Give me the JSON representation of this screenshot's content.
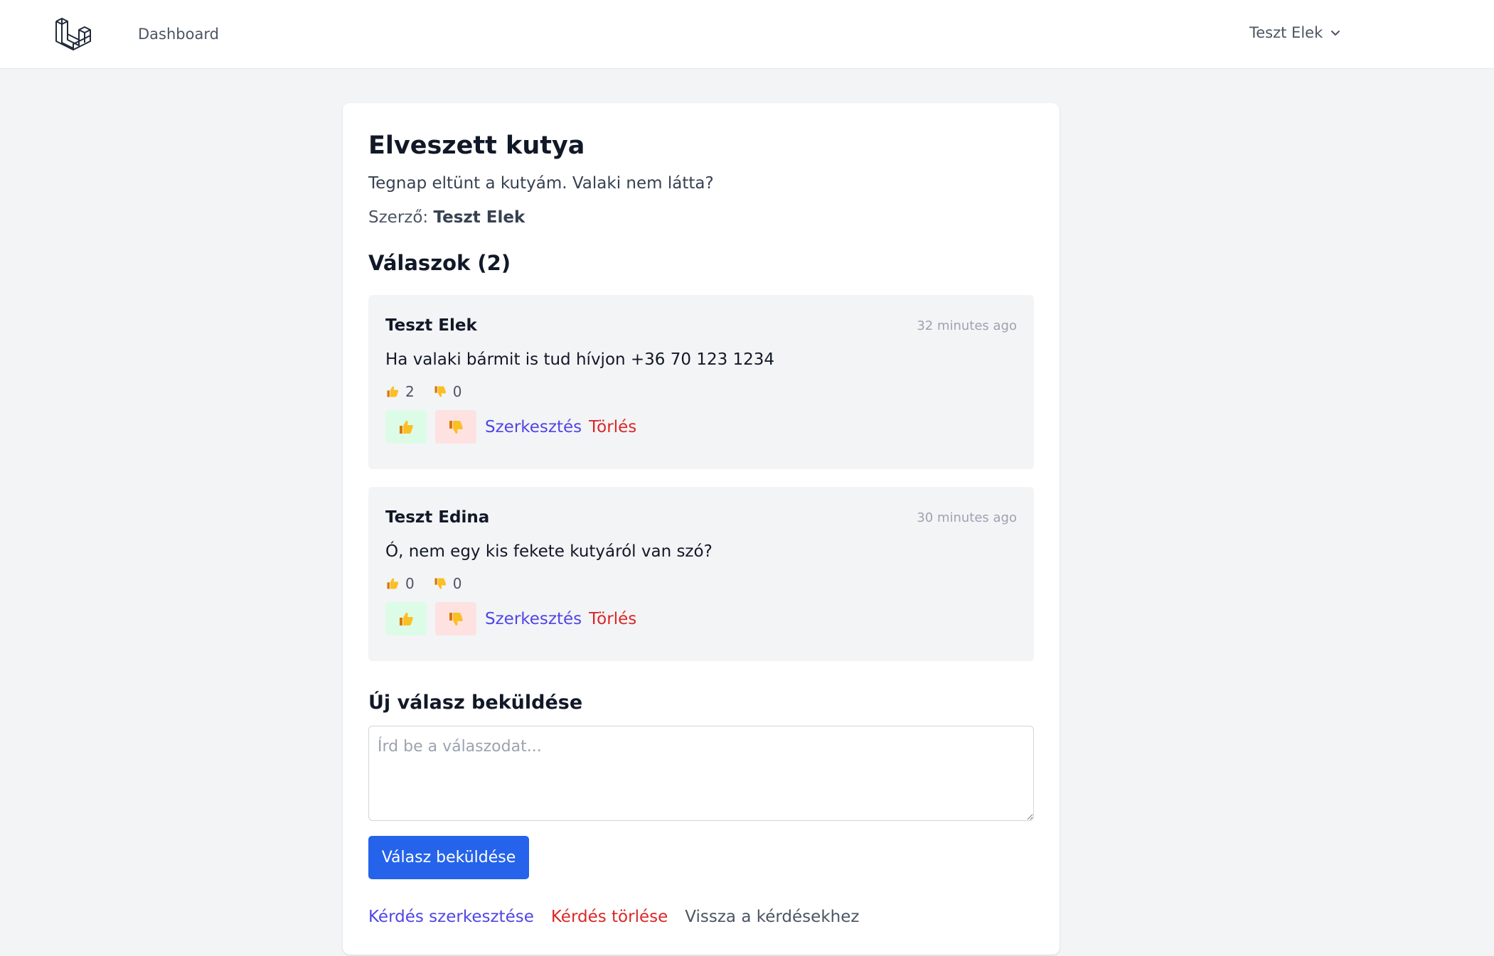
{
  "nav": {
    "dashboard_label": "Dashboard",
    "user_name": "Teszt Elek"
  },
  "question": {
    "title": "Elveszett kutya",
    "body": "Tegnap eltünt a kutyám. Valaki nem látta?",
    "author_prefix": "Szerző:",
    "author": "Teszt Elek"
  },
  "answers_heading": "Válaszok (2)",
  "answers": [
    {
      "author": "Teszt Elek",
      "time": "32 minutes ago",
      "text": "Ha valaki bármit is tud hívjon +36 70 123 1234",
      "likes": "2",
      "dislikes": "0",
      "edit_label": "Szerkesztés",
      "delete_label": "Törlés"
    },
    {
      "author": "Teszt Edina",
      "time": "30 minutes ago",
      "text": "Ó, nem egy kis fekete kutyáról van szó?",
      "likes": "0",
      "dislikes": "0",
      "edit_label": "Szerkesztés",
      "delete_label": "Törlés"
    }
  ],
  "new_answer": {
    "heading": "Új válasz beküldése",
    "placeholder": "Írd be a válaszodat...",
    "value": "",
    "submit_label": "Válasz beküldése"
  },
  "footer_links": {
    "edit_question": "Kérdés szerkesztése",
    "delete_question": "Kérdés törlése",
    "back": "Vissza a kérdésekhez"
  },
  "icons": {
    "logo": "laravel-logo-icon",
    "dropdown": "chevron-down-icon",
    "like": "thumbs-up-icon",
    "dislike": "thumbs-down-icon"
  },
  "colors": {
    "primary": "#2563eb",
    "link": "#4f46e5",
    "danger": "#dc2626",
    "like_bg": "#dcfce7",
    "dislike_bg": "#fee2e2"
  }
}
